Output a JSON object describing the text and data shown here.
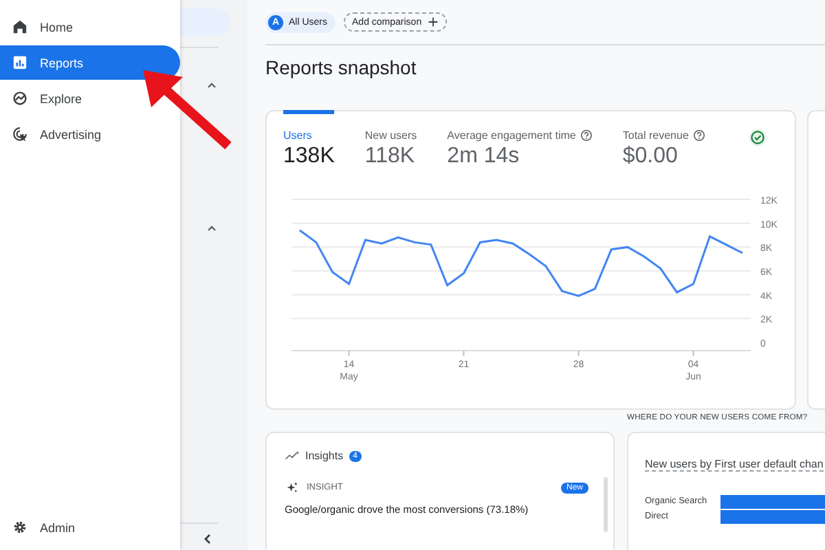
{
  "nav": {
    "items": [
      {
        "kind": "home",
        "label": "Home",
        "selected": false
      },
      {
        "kind": "reports",
        "label": "Reports",
        "selected": true
      },
      {
        "kind": "explore",
        "label": "Explore",
        "selected": false
      },
      {
        "kind": "advertising",
        "label": "Advertising",
        "selected": false
      }
    ],
    "admin": {
      "label": "Admin"
    }
  },
  "filters": {
    "segment": {
      "badge": "A",
      "label": "All Users"
    },
    "add_comparison": "Add comparison"
  },
  "title": "Reports snapshot",
  "snapshot": {
    "metrics": [
      {
        "label": "Users",
        "value": "138K",
        "selected": true,
        "help": false
      },
      {
        "label": "New users",
        "value": "118K",
        "selected": false,
        "help": false
      },
      {
        "label": "Average engagement time",
        "value": "2m 14s",
        "selected": false,
        "help": true
      },
      {
        "label": "Total revenue",
        "value": "$0.00",
        "selected": false,
        "help": true
      }
    ],
    "chart_data": {
      "type": "line",
      "grid": true,
      "x": [
        11,
        12,
        13,
        14,
        15,
        16,
        17,
        18,
        19,
        20,
        21,
        22,
        23,
        24,
        25,
        26,
        27,
        28,
        29,
        30,
        31,
        32,
        33,
        34,
        35,
        36,
        37,
        38
      ],
      "series": [
        {
          "color": "#4285f4",
          "values": [
            9400,
            8400,
            5900,
            4900,
            8600,
            8300,
            8800,
            8400,
            8200,
            4800,
            5800,
            8400,
            8600,
            8300,
            7400,
            6400,
            4300,
            3900,
            4500,
            7800,
            8000,
            7200,
            6200,
            4200,
            4900,
            8900,
            8200,
            7500
          ]
        }
      ],
      "xlim": [
        10.5,
        38.5
      ],
      "ylim": [
        0,
        12000
      ],
      "yticks": [
        {
          "value": 0,
          "label": "0"
        },
        {
          "value": 2000,
          "label": "2K"
        },
        {
          "value": 4000,
          "label": "4K"
        },
        {
          "value": 6000,
          "label": "6K"
        },
        {
          "value": 8000,
          "label": "8K"
        },
        {
          "value": 10000,
          "label": "10K"
        },
        {
          "value": 12000,
          "label": "12K"
        }
      ],
      "xticks": [
        {
          "value": 14,
          "label": "14\nMay"
        },
        {
          "value": 21,
          "label": "21"
        },
        {
          "value": 28,
          "label": "28"
        },
        {
          "value": 35,
          "label": "04\nJun"
        }
      ]
    }
  },
  "new_users": {
    "heading": "WHERE DO YOUR NEW USERS COME FROM?",
    "card_title": "New users by First user default chan",
    "rows": [
      {
        "label": "Organic Search"
      },
      {
        "label": "Direct"
      }
    ]
  },
  "insights": {
    "title": "Insights",
    "count": "4",
    "item": {
      "label": "INSIGHT",
      "badge": "New",
      "text": "Google/organic drove the most conversions (73.18%)"
    }
  }
}
